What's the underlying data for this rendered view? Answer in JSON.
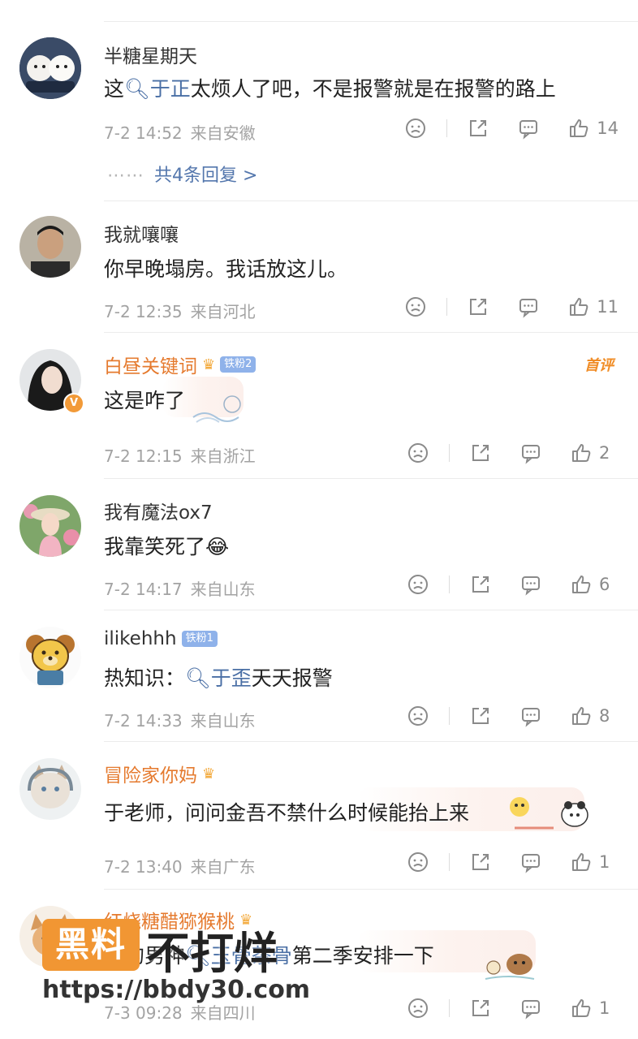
{
  "comments": [
    {
      "username": "半糖星期天",
      "text_before": "这",
      "link": "于正",
      "text_after": "太烦人了吧，不是报警就是在报警的路上",
      "time": "7-2 14:52",
      "location": "来自安徽",
      "likes": "14",
      "replies": "共4条回复 >",
      "avatar": "two-white-dogs"
    },
    {
      "username": "我就嚷嚷",
      "text": "你早晚塌房。我话放这儿。",
      "time": "7-2 12:35",
      "location": "来自河北",
      "likes": "11",
      "avatar": "man-portrait"
    },
    {
      "username": "白昼关键词",
      "fan_badge": "铁粉2",
      "badge_label": "首评",
      "text": "这是咋了",
      "time": "7-2 12:15",
      "location": "来自浙江",
      "likes": "2",
      "avatar": "woman-portrait",
      "verified": "V"
    },
    {
      "username": "我有魔法ox7",
      "text": "我靠笑死了",
      "emoji": "😂",
      "time": "7-2 14:17",
      "location": "来自山东",
      "likes": "6",
      "avatar": "woman-flowers"
    },
    {
      "username": "ilikehhh",
      "fan_badge": "铁粉1",
      "text_before": "热知识：",
      "link": "于歪",
      "text_after": "天天报警",
      "time": "7-2 14:33",
      "location": "来自山东",
      "likes": "8",
      "avatar": "cartoon-dog"
    },
    {
      "username": "冒险家你妈",
      "text": "于老师，问问金吾不禁什么时候能抬上来",
      "time": "7-2 13:40",
      "location": "来自广东",
      "likes": "1",
      "avatar": "cat-headphones"
    },
    {
      "username": "红烧糖醋猕猴桃",
      "text_before": "好的男神",
      "link": "玉骨茶骨",
      "text_after": "第二季安排一下",
      "time": "7-3 09:28",
      "location": "来自四川",
      "likes": "1",
      "avatar": "cartoon-animal"
    }
  ],
  "watermark": {
    "box": "黑料",
    "title": "不打烊",
    "url": "https://bbdy30.com"
  },
  "colors": {
    "link": "#4a6fa5",
    "orange_name": "#e57a2e",
    "meta": "#a3a3a3",
    "watermark_orange": "#f19633"
  }
}
